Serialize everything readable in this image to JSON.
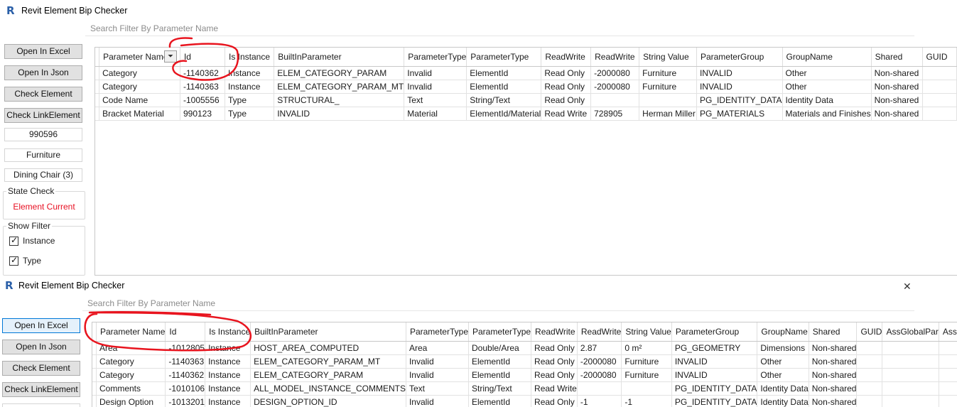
{
  "windows": [
    {
      "title": "Revit Element Bip Checker",
      "search_placeholder": "Search Filter By Parameter Name",
      "buttons": [
        "Open In Excel",
        "Open In Json",
        "Check Element",
        "Check LinkElement"
      ],
      "info": [
        "990596",
        "Furniture",
        "Dining Chair (3)"
      ],
      "state_check": {
        "label": "State Check",
        "value": "Element Current",
        "value_color": "#e81123"
      },
      "show_filter": {
        "label": "Show Filter",
        "options": [
          {
            "label": "Instance",
            "checked": true
          },
          {
            "label": "Type",
            "checked": true
          }
        ]
      },
      "columns": [
        "Parameter Name",
        "Id",
        "Is Instance",
        "BuiltInParameter",
        "ParameterType",
        "ParameterType",
        "ReadWrite",
        "ReadWrite",
        "String Value",
        "ParameterGroup",
        "GroupName",
        "Shared",
        "GUID"
      ],
      "rows": [
        [
          "Category",
          "-1140362",
          "Instance",
          "ELEM_CATEGORY_PARAM",
          "Invalid",
          "ElementId",
          "Read Only",
          "-2000080",
          "Furniture",
          "INVALID",
          "Other",
          "Non-shared",
          ""
        ],
        [
          "Category",
          "-1140363",
          "Instance",
          "ELEM_CATEGORY_PARAM_MT",
          "Invalid",
          "ElementId",
          "Read Only",
          "-2000080",
          "Furniture",
          "INVALID",
          "Other",
          "Non-shared",
          ""
        ],
        [
          "Code Name",
          "-1005556",
          "Type",
          "STRUCTURAL_",
          "Text",
          "String/Text",
          "Read Only",
          "",
          "",
          "PG_IDENTITY_DATA",
          "Identity Data",
          "Non-shared",
          ""
        ],
        [
          "Bracket Material",
          "990123",
          "Type",
          "INVALID",
          "Material",
          "ElementId/Material",
          "Read Write",
          "728905",
          "Herman Miller",
          "PG_MATERIALS",
          "Materials and Finishes",
          "Non-shared",
          ""
        ]
      ]
    },
    {
      "title": "Revit Element Bip Checker",
      "search_placeholder": "Search Filter By Parameter Name",
      "buttons": [
        "Open In Excel",
        "Open In Json",
        "Check Element",
        "Check LinkElement"
      ],
      "columns": [
        "Parameter Name",
        "Id",
        "Is Instance",
        "BuiltInParameter",
        "ParameterType",
        "ParameterType",
        "ReadWrite",
        "ReadWrite",
        "String Value",
        "ParameterGroup",
        "GroupName",
        "Shared",
        "GUID",
        "AssGlobalPar",
        "Ass"
      ],
      "rows": [
        [
          "Area",
          "-1012805",
          "Instance",
          "HOST_AREA_COMPUTED",
          "Area",
          "Double/Area",
          "Read Only",
          "2.87",
          "0 m²",
          "PG_GEOMETRY",
          "Dimensions",
          "Non-shared",
          "",
          "",
          ""
        ],
        [
          "Category",
          "-1140363",
          "Instance",
          "ELEM_CATEGORY_PARAM_MT",
          "Invalid",
          "ElementId",
          "Read Only",
          "-2000080",
          "Furniture",
          "INVALID",
          "Other",
          "Non-shared",
          "",
          "",
          ""
        ],
        [
          "Category",
          "-1140362",
          "Instance",
          "ELEM_CATEGORY_PARAM",
          "Invalid",
          "ElementId",
          "Read Only",
          "-2000080",
          "Furniture",
          "INVALID",
          "Other",
          "Non-shared",
          "",
          "",
          ""
        ],
        [
          "Comments",
          "-1010106",
          "Instance",
          "ALL_MODEL_INSTANCE_COMMENTS",
          "Text",
          "String/Text",
          "Read Write",
          "",
          "",
          "PG_IDENTITY_DATA",
          "Identity Data",
          "Non-shared",
          "",
          "",
          ""
        ],
        [
          "Design Option",
          "-1013201",
          "Instance",
          "DESIGN_OPTION_ID",
          "Invalid",
          "ElementId",
          "Read Only",
          "-1",
          "-1",
          "PG_IDENTITY_DATA",
          "Identity Data",
          "Non-shared",
          "",
          "",
          ""
        ]
      ]
    }
  ],
  "icons": {
    "app": "revit-logo-icon",
    "filter": "funnel-icon",
    "close": "close-icon"
  },
  "close_symbol": "✕",
  "app_letter": "R",
  "filter_symbol": "⏷",
  "annotation_color": "#e8141e"
}
